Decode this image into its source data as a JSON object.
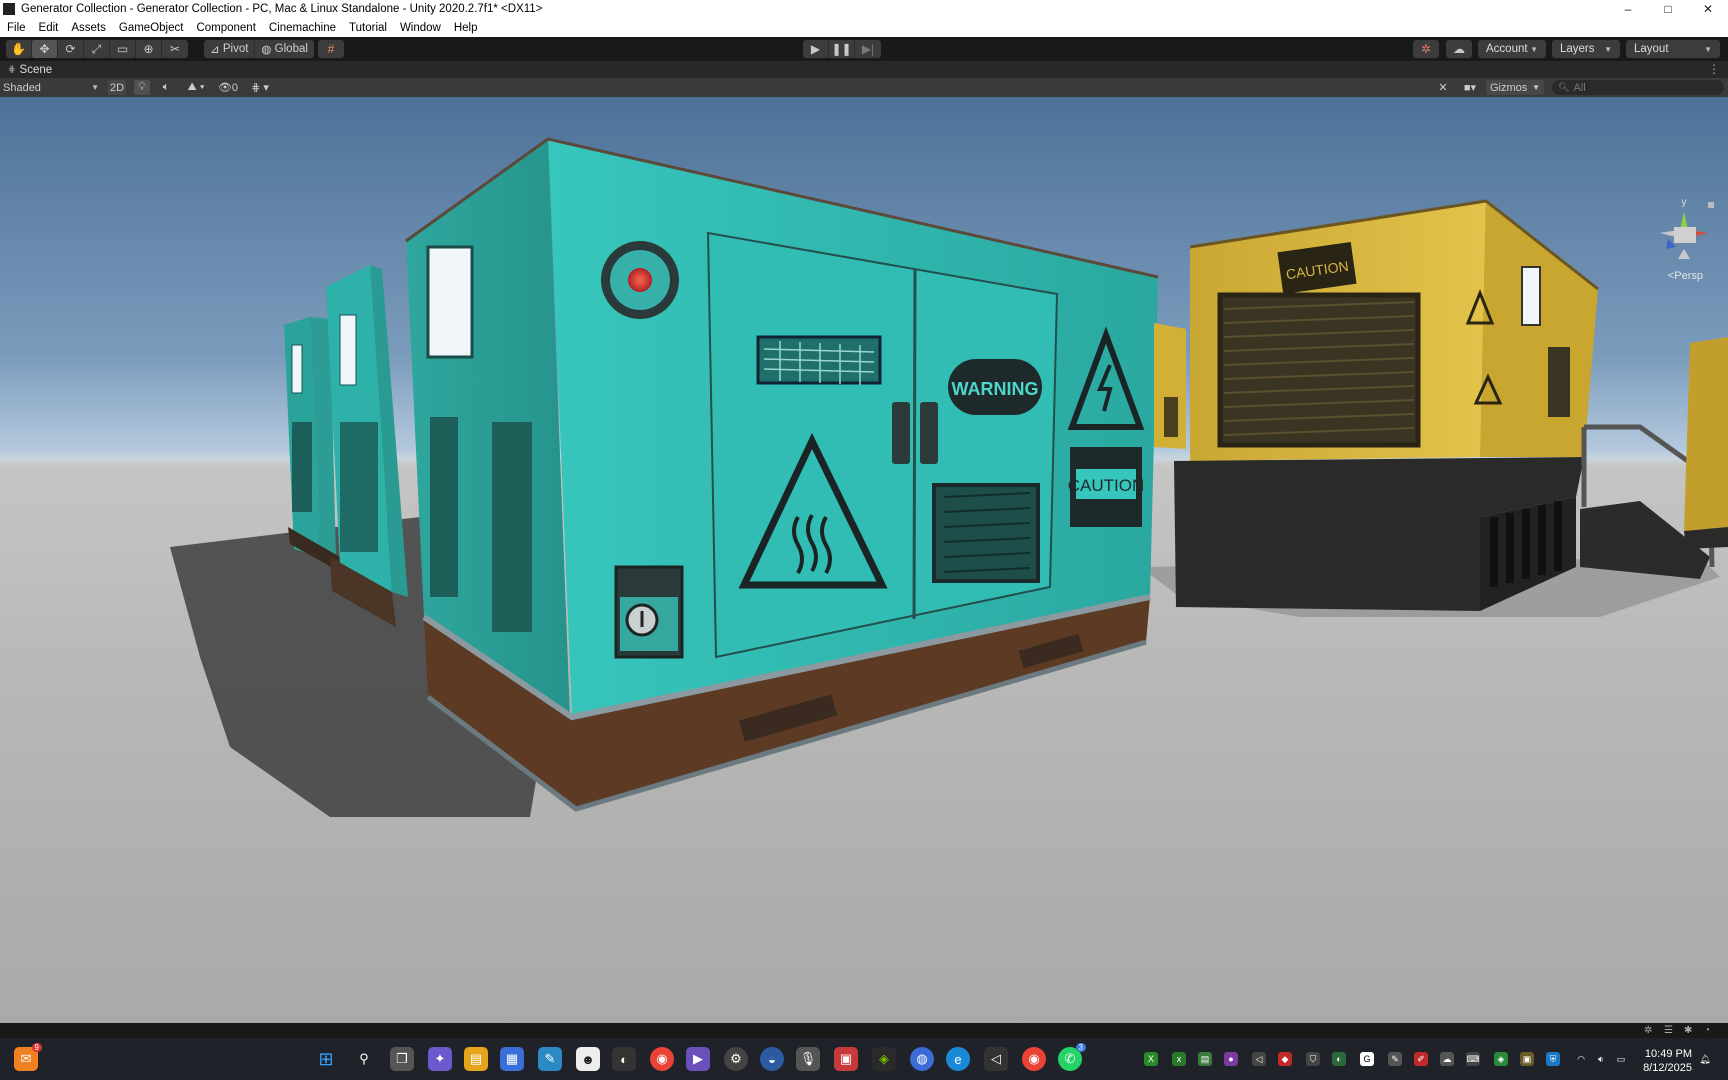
{
  "window": {
    "title": "Generator Collection - Generator Collection - PC, Mac & Linux Standalone - Unity 2020.2.7f1* <DX11>",
    "minimize": "–",
    "maximize": "□",
    "close": "✕"
  },
  "menu": [
    "File",
    "Edit",
    "Assets",
    "GameObject",
    "Component",
    "Cinemachine",
    "Tutorial",
    "Window",
    "Help"
  ],
  "toolbar": {
    "pivot_label": "Pivot",
    "global_label": "Global",
    "account_label": "Account",
    "layers_label": "Layers",
    "layout_label": "Layout"
  },
  "scene_tab": {
    "label": "Scene"
  },
  "scene_toolbar": {
    "shading_mode": "Shaded",
    "mode_2d": "2D",
    "hidden_count": "0",
    "gizmos_label": "Gizmos",
    "search_placeholder": "All"
  },
  "viewport": {
    "persp_label": "<Persp",
    "axis_y": "y",
    "decals": {
      "warning": "WARNING",
      "caution_front": "CAUTION",
      "caution_yellow": "CAUTION"
    }
  },
  "taskbar": {
    "notification_badge": "9",
    "whatsapp_badge": "3",
    "time": "10:49 PM",
    "date": "8/12/2025"
  },
  "colors": {
    "teal_generator": "#2fb5ad",
    "yellow_generator": "#d9b73a",
    "unity_dark": "#191919"
  }
}
